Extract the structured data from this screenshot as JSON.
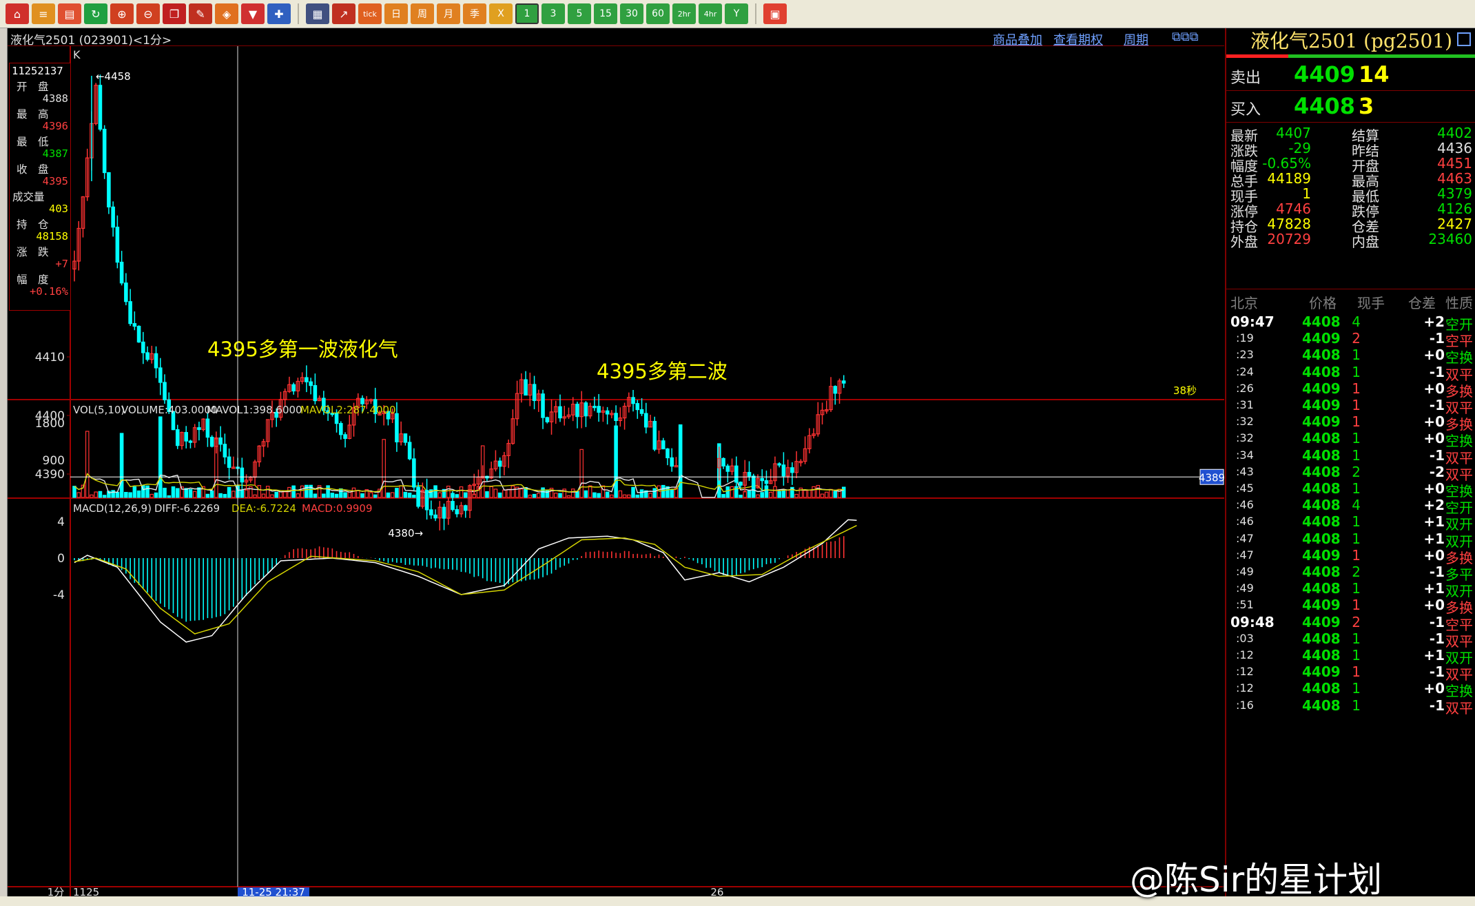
{
  "toolbar": {
    "tick": "tick",
    "day": "日",
    "week": "周",
    "month": "月",
    "quarter": "季",
    "p1": "1",
    "p3": "3",
    "p5": "5",
    "p15": "15",
    "p30": "30",
    "p60": "60",
    "p2h": "2hr",
    "p4h": "4hr",
    "year": "Y"
  },
  "chart_header": {
    "title": "液化气2501 (023901)<1分>",
    "link_overlay": "商品叠加",
    "link_options": "查看期权",
    "link_period": "周期"
  },
  "info_box": {
    "time": "11252137",
    "open_label": "开　盘",
    "open": "4388",
    "high_label": "最　高",
    "high": "4396",
    "low_label": "最　低",
    "low": "4387",
    "close_label": "收　盘",
    "close": "4395",
    "volume_label": "成交量",
    "volume": "403",
    "oi_label": "持　仓",
    "oi": "48158",
    "change_label": "涨　跌",
    "change": "+7",
    "range_label": "幅　度",
    "range": "+0.16%"
  },
  "kline": {
    "k_label": "K",
    "high_marker": "4458",
    "low_marker": "4380",
    "y_ticks": [
      "4410",
      "4400",
      "4390"
    ],
    "current_price_tag": "4389",
    "countdown": "38秒",
    "annotation_1": "4395多第一波液化气",
    "annotation_2": "4395多第二波"
  },
  "volume_panel": {
    "legend_name": "VOL(5,10)",
    "volume": "VOLUME:403.0000",
    "mavol1": "MAVOL1:398.6000",
    "mavol2": "MAVOL2:287.4000",
    "y_ticks": [
      "1800",
      "900"
    ]
  },
  "macd_panel": {
    "legend_name": "MACD(12,26,9)",
    "diff": "DIFF:-6.2269",
    "dea": "DEA:-6.7224",
    "macd": "MACD:0.9909",
    "y_ticks": [
      "4",
      "0",
      "-4"
    ]
  },
  "x_axis": {
    "period": "1分",
    "start_label": "1125",
    "cursor_label": "11-25 21:37",
    "day_label": "26"
  },
  "quote_panel": {
    "title": "液化气2501 (pg2501)",
    "ask_label": "卖出",
    "ask_price": "4409",
    "ask_vol": "14",
    "bid_label": "买入",
    "bid_price": "4408",
    "bid_vol": "3",
    "stats": [
      {
        "l1": "最新",
        "v1": "4407",
        "c1": "#00e000",
        "l2": "结算",
        "v2": "4402",
        "c2": "#00e000"
      },
      {
        "l1": "涨跌",
        "v1": "-29",
        "c1": "#00e000",
        "l2": "昨结",
        "v2": "4436",
        "c2": "#e0e0e0"
      },
      {
        "l1": "幅度",
        "v1": "-0.65%",
        "c1": "#00e000",
        "l2": "开盘",
        "v2": "4451",
        "c2": "#ff4040"
      },
      {
        "l1": "总手",
        "v1": "44189",
        "c1": "#ffff00",
        "l2": "最高",
        "v2": "4463",
        "c2": "#ff4040"
      },
      {
        "l1": "现手",
        "v1": "1",
        "c1": "#ffff00",
        "l2": "最低",
        "v2": "4379",
        "c2": "#00e000"
      },
      {
        "l1": "涨停",
        "v1": "4746",
        "c1": "#ff4040",
        "l2": "跌停",
        "v2": "4126",
        "c2": "#00e000"
      },
      {
        "l1": "持仓",
        "v1": "47828",
        "c1": "#ffff00",
        "l2": "仓差",
        "v2": "2427",
        "c2": "#ffff00"
      },
      {
        "l1": "外盘",
        "v1": "20729",
        "c1": "#ff4040",
        "l2": "内盘",
        "v2": "23460",
        "c2": "#00e000"
      }
    ],
    "tick_headers": {
      "time": "北京",
      "price": "价格",
      "vol": "现手",
      "oi": "仓差",
      "type": "性质"
    },
    "ticks": [
      {
        "t": "09:47",
        "p": "4408",
        "v": "4",
        "o": "+2",
        "n": "空开",
        "big": true
      },
      {
        "t": ":19",
        "p": "4409",
        "v": "2",
        "o": "-1",
        "n": "空平"
      },
      {
        "t": ":23",
        "p": "4408",
        "v": "1",
        "o": "+0",
        "n": "空换"
      },
      {
        "t": ":24",
        "p": "4408",
        "v": "1",
        "o": "-1",
        "n": "双平"
      },
      {
        "t": ":26",
        "p": "4409",
        "v": "1",
        "o": "+0",
        "n": "多换"
      },
      {
        "t": ":31",
        "p": "4409",
        "v": "1",
        "o": "-1",
        "n": "双平"
      },
      {
        "t": ":32",
        "p": "4409",
        "v": "1",
        "o": "+0",
        "n": "多换"
      },
      {
        "t": ":32",
        "p": "4408",
        "v": "1",
        "o": "+0",
        "n": "空换"
      },
      {
        "t": ":34",
        "p": "4408",
        "v": "1",
        "o": "-1",
        "n": "双平"
      },
      {
        "t": ":43",
        "p": "4408",
        "v": "2",
        "o": "-2",
        "n": "双平"
      },
      {
        "t": ":45",
        "p": "4408",
        "v": "1",
        "o": "+0",
        "n": "空换"
      },
      {
        "t": ":46",
        "p": "4408",
        "v": "4",
        "o": "+2",
        "n": "空开"
      },
      {
        "t": ":46",
        "p": "4408",
        "v": "1",
        "o": "+1",
        "n": "双开"
      },
      {
        "t": ":47",
        "p": "4408",
        "v": "1",
        "o": "+1",
        "n": "双开"
      },
      {
        "t": ":47",
        "p": "4409",
        "v": "1",
        "o": "+0",
        "n": "多换"
      },
      {
        "t": ":49",
        "p": "4408",
        "v": "2",
        "o": "-1",
        "n": "多平"
      },
      {
        "t": ":49",
        "p": "4408",
        "v": "1",
        "o": "+1",
        "n": "双开"
      },
      {
        "t": ":51",
        "p": "4409",
        "v": "1",
        "o": "+0",
        "n": "多换"
      },
      {
        "t": "09:48",
        "p": "4409",
        "v": "2",
        "o": "-1",
        "n": "空平",
        "big": true
      },
      {
        "t": ":03",
        "p": "4408",
        "v": "1",
        "o": "-1",
        "n": "双平"
      },
      {
        "t": ":12",
        "p": "4408",
        "v": "1",
        "o": "+1",
        "n": "双开"
      },
      {
        "t": ":12",
        "p": "4409",
        "v": "1",
        "o": "-1",
        "n": "双平"
      },
      {
        "t": ":12",
        "p": "4408",
        "v": "1",
        "o": "+0",
        "n": "空换"
      },
      {
        "t": ":16",
        "p": "4408",
        "v": "1",
        "o": "-1",
        "n": "双平"
      }
    ]
  },
  "watermark": "@陈Sir的星计划",
  "colors": {
    "up": "#ff3232",
    "down": "#00ffff",
    "ma1": "#e8e8e8",
    "ma2": "#d4d400",
    "frame": "#a00000",
    "annotation": "#ffff00"
  }
}
